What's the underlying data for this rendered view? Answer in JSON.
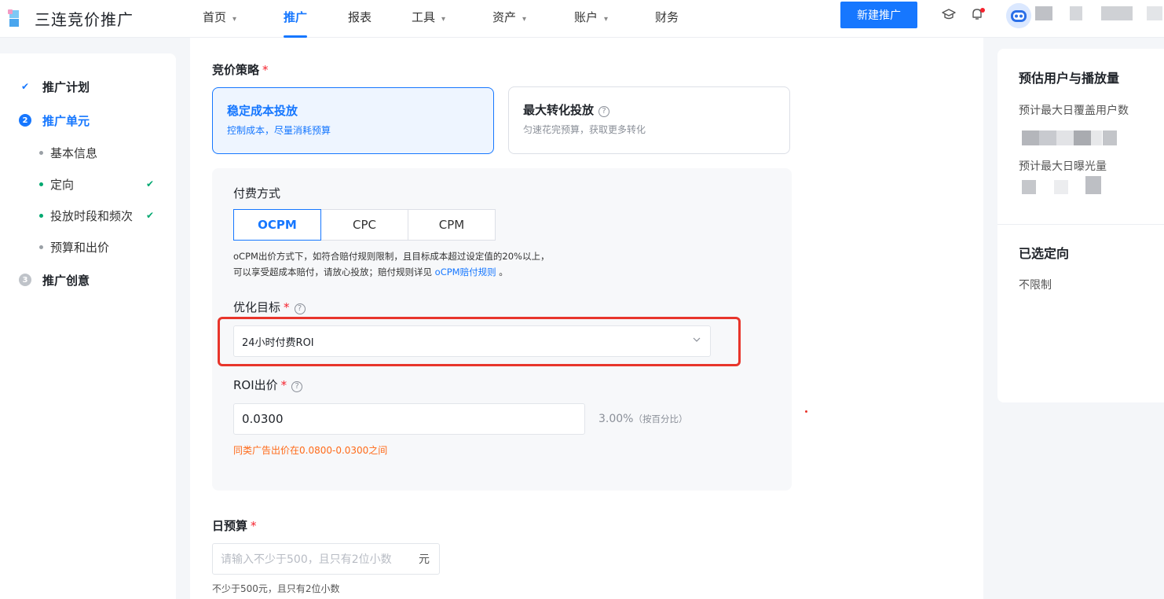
{
  "header": {
    "logo_text": "三连竞价推广",
    "nav": [
      {
        "label": "首页",
        "has_caret": true,
        "active": false
      },
      {
        "label": "推广",
        "has_caret": false,
        "active": true
      },
      {
        "label": "报表",
        "has_caret": false,
        "active": false
      },
      {
        "label": "工具",
        "has_caret": true,
        "active": false
      },
      {
        "label": "资产",
        "has_caret": true,
        "active": false
      },
      {
        "label": "账户",
        "has_caret": true,
        "active": false
      },
      {
        "label": "财务",
        "has_caret": false,
        "active": false
      }
    ],
    "new_button": "新建推广",
    "caret_glyph": "▾",
    "icons": [
      "graduation-cap-icon",
      "bell-icon",
      "avatar"
    ],
    "notification_dot_color": "#f5222d"
  },
  "sidebar": {
    "steps": [
      {
        "label": "推广计划",
        "status": "done",
        "marker": "✔"
      },
      {
        "label": "推广单元",
        "status": "current",
        "marker": "2"
      },
      {
        "label": "推广创意",
        "status": "todo",
        "marker": "3"
      }
    ],
    "sub_items": [
      {
        "label": "基本信息",
        "checked": false
      },
      {
        "label": "定向",
        "checked": true
      },
      {
        "label": "投放时段和频次",
        "checked": true
      },
      {
        "label": "预算和出价",
        "checked": false
      }
    ],
    "check_glyph": "✔"
  },
  "main": {
    "strategy": {
      "label": "竞价策略",
      "required_mark": "*",
      "options": [
        {
          "title": "稳定成本投放",
          "desc": "控制成本，尽量消耗预算",
          "selected": true
        },
        {
          "title": "最大转化投放",
          "desc": "匀速花完预算，获取更多转化",
          "selected": false
        }
      ],
      "help_glyph": "?"
    },
    "payment": {
      "label": "付费方式",
      "options": [
        "OCPM",
        "CPC",
        "CPM"
      ],
      "selected": "OCPM",
      "note_line1": "oCPM出价方式下，如符合赔付规则限制，且目标成本超过设定值的20%以上，",
      "note_line2_prefix": "可以享受超成本赔付，请放心投放；赔付规则详见 ",
      "note_link": "oCPM赔付规则",
      "note_line2_suffix": " 。"
    },
    "optimize": {
      "label": "优化目标",
      "required_mark": "*",
      "value": "24小时付费ROI"
    },
    "roi": {
      "label": "ROI出价",
      "required_mark": "*",
      "value": "0.0300",
      "percent": "3.00%",
      "percent_note": "（按百分比）",
      "hint": "同类广告出价在0.0800-0.0300之间"
    },
    "budget": {
      "label": "日预算",
      "required_mark": "*",
      "placeholder": "请输入不少于500，且只有2位小数",
      "unit": "元",
      "note": "不少于500元，且只有2位小数"
    }
  },
  "right_panel": {
    "title": "预估用户与播放量",
    "coverage_label": "预计最大日覆盖用户数",
    "exposure_label": "预计最大日曝光量",
    "targeting_title": "已选定向",
    "targeting_value": "不限制"
  },
  "colors": {
    "accent": "#1677ff",
    "required": "#f5222d",
    "warning": "#ff6b1a",
    "success": "#00a870",
    "highlight_box": "#e8352b"
  }
}
